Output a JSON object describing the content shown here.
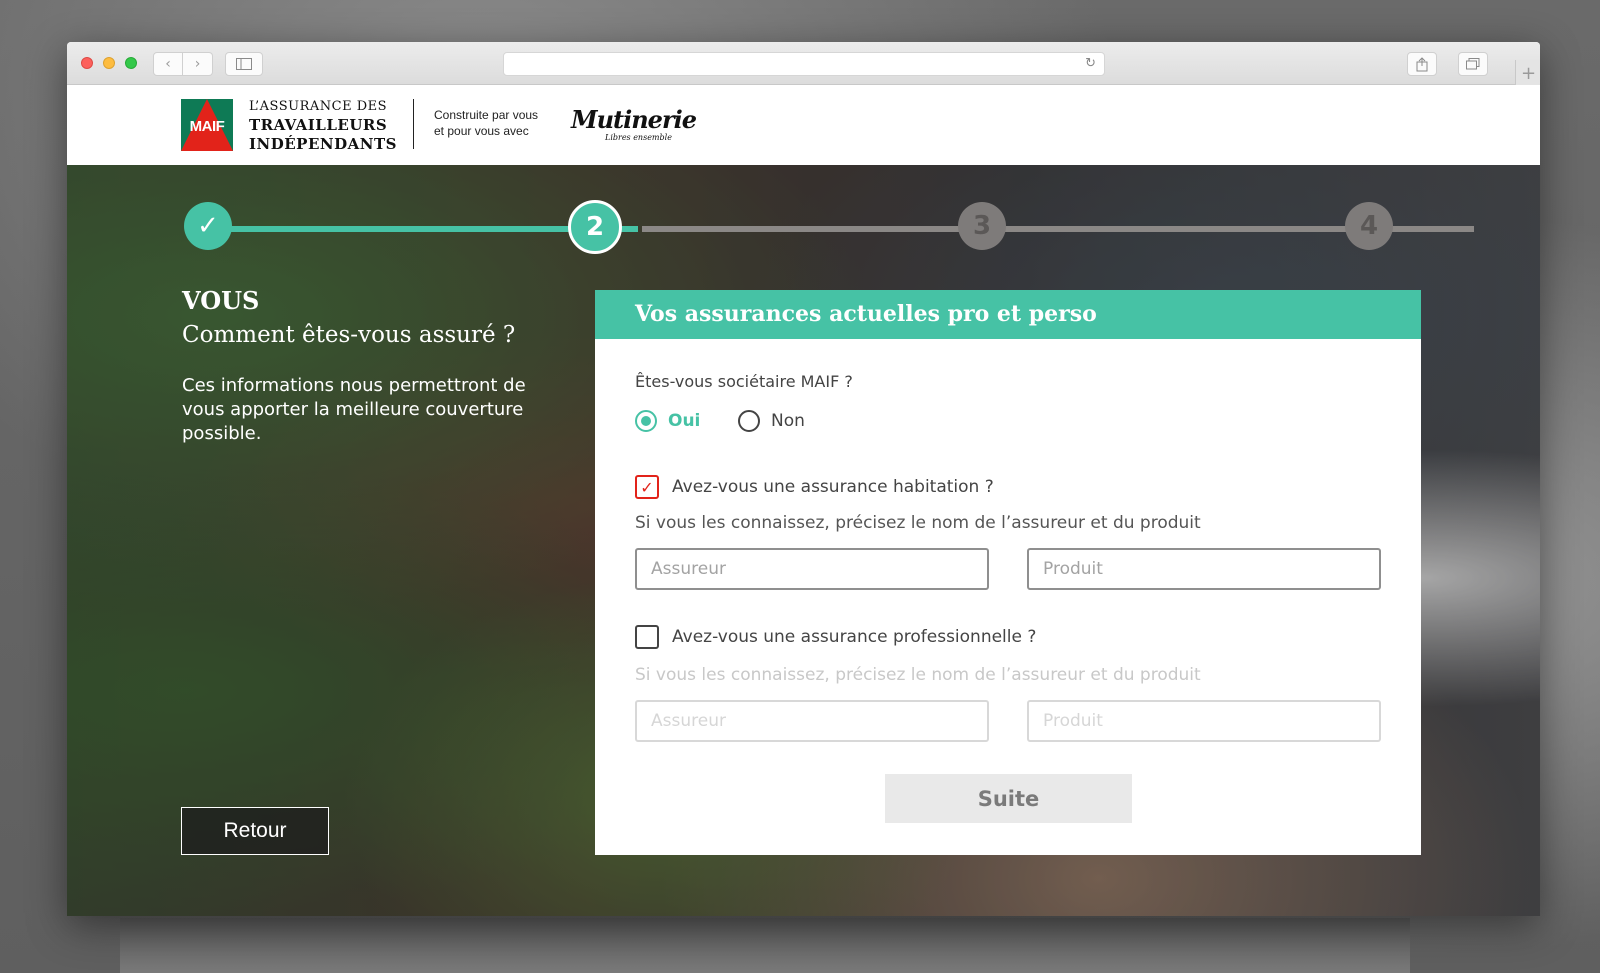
{
  "browser": {
    "url": "",
    "icons": {
      "back": "chevron-left-icon",
      "forward": "chevron-right-icon",
      "sidebar": "sidebar-icon",
      "reload": "reload-icon",
      "share": "share-icon",
      "tabs": "tabs-icon",
      "new_tab": "plus-icon"
    }
  },
  "header": {
    "maif_logo_text": "MAIF",
    "brand_line1": "L’ASSURANCE DES",
    "brand_line2": "TRAVAILLEURS",
    "brand_line3": "INDÉPENDANTS",
    "built_by_line1": "Construite par vous",
    "built_by_line2": "et pour vous avec",
    "partner_logo": "Mutinerie",
    "partner_tagline": "Libres ensemble"
  },
  "stepper": {
    "steps": [
      {
        "label": "✓",
        "state": "done"
      },
      {
        "label": "2",
        "state": "current"
      },
      {
        "label": "3",
        "state": "todo"
      },
      {
        "label": "4",
        "state": "todo"
      }
    ],
    "colors": {
      "active": "#46c2a5",
      "inactive": "#7e7b7a"
    }
  },
  "intro": {
    "title": "VOUS",
    "subtitle": "Comment êtes-vous assuré ?",
    "description": "Ces informations nous permettront de vous apporter la meilleure couverture possible."
  },
  "form": {
    "header": "Vos assurances actuelles pro et perso",
    "member_question": "Êtes-vous sociétaire MAIF ?",
    "member_options": [
      {
        "label": "Oui",
        "checked": true
      },
      {
        "label": "Non",
        "checked": false
      }
    ],
    "home_insurance": {
      "question": "Avez-vous une assurance habitation ?",
      "checked": true,
      "checkmark": "✓",
      "hint": "Si vous les connaissez, précisez le nom de l’assureur et du produit",
      "insurer_placeholder": "Assureur",
      "product_placeholder": "Produit",
      "enabled": true
    },
    "pro_insurance": {
      "question": "Avez-vous une assurance professionnelle ?",
      "checked": false,
      "checkmark": "",
      "hint": "Si vous les connaissez, précisez le nom de l’assureur et du produit",
      "insurer_placeholder": "Assureur",
      "product_placeholder": "Produit",
      "enabled": false
    },
    "next_label": "Suite"
  },
  "back_label": "Retour",
  "colors": {
    "accent": "#46c2a5",
    "maif_red": "#e2231a",
    "maif_green": "#0e7a55"
  }
}
